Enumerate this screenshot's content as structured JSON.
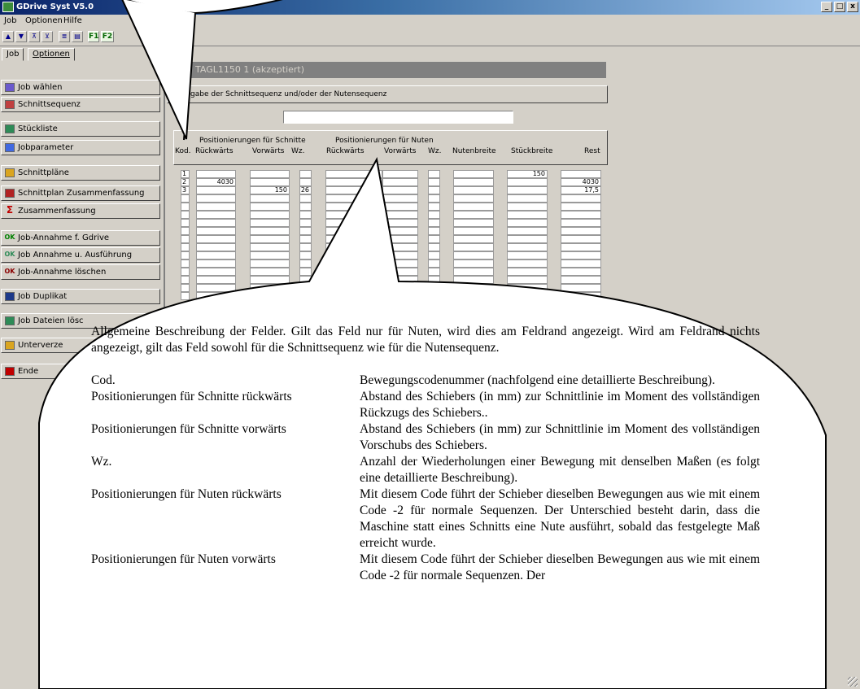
{
  "window": {
    "title": "GDrive Syst V5.0",
    "min": "_",
    "max": "□",
    "close": "x"
  },
  "menu": [
    "Job",
    "Optionen",
    "Hilfe"
  ],
  "toolbar": {
    "f1": "F1",
    "f2": "F2"
  },
  "tabs": [
    {
      "label": "Job"
    },
    {
      "label": "Optionen"
    }
  ],
  "sidebar": {
    "items": [
      {
        "label": "Job wählen",
        "icon": "folder-icon"
      },
      {
        "label": "Schnittsequenz",
        "icon": "sequence-icon"
      },
      {
        "label": "Stückliste",
        "icon": "list-icon"
      },
      {
        "label": "Jobparameter",
        "icon": "params-icon"
      },
      {
        "label": "Schnittpläne",
        "icon": "plan-icon"
      },
      {
        "label": "Schnittplan Zusammenfassung",
        "icon": "summary-plan-icon"
      },
      {
        "label": "Zusammenfassung",
        "icon": "sigma-icon",
        "glyph": "Σ"
      },
      {
        "label": "Job-Annahme f. Gdrive",
        "icon": "ok-icon",
        "glyph": "OK"
      },
      {
        "label": "Job Annahme u. Ausführung",
        "icon": "ok-run-icon",
        "glyph": "OK"
      },
      {
        "label": "Job-Annahme löschen",
        "icon": "ok-delete-icon",
        "glyph": "OK"
      },
      {
        "label": "Job Duplikat",
        "icon": "disk-icon"
      },
      {
        "label": "Job Dateien lösc",
        "icon": "delete-files-icon"
      },
      {
        "label": "Unterverze",
        "icon": "subfolder-icon"
      },
      {
        "label": "Ende",
        "icon": "exit-icon"
      }
    ]
  },
  "job_header": "TAGL1150  1 (akzeptiert)",
  "sequence_label": "gabe der Schnittsequenz und/oder der Nutensequenz",
  "sequence_input": "",
  "grid": {
    "group_cuts": "Positionierungen für Schnitte",
    "group_grooves": "Positionierungen für Nuten",
    "columns": [
      "Kod.",
      "Rückwärts",
      "Vorwärts",
      "Wz.",
      "Rückwärts",
      "Vorwärts",
      "Wz.",
      "Nutenbreite",
      "Stückbreite",
      "Rest"
    ],
    "rows": [
      {
        "kod": "1",
        "cut_back": "",
        "cut_fwd": "",
        "wz": "",
        "groove_back": "",
        "groove_fwd": "",
        "gwz": "",
        "groove_width": "",
        "piece_width": "150",
        "rest": ""
      },
      {
        "kod": "2",
        "cut_back": "4030",
        "cut_fwd": "",
        "wz": "",
        "groove_back": "",
        "groove_fwd": "",
        "gwz": "",
        "groove_width": "",
        "piece_width": "",
        "rest": "4030"
      },
      {
        "kod": "3",
        "cut_back": "",
        "cut_fwd": "150",
        "wz": "26",
        "groove_back": "",
        "groove_fwd": "",
        "gwz": "",
        "groove_width": "",
        "piece_width": "",
        "rest": "17,5"
      }
    ]
  },
  "description": {
    "intro": "Allgemeine Beschreibung der Felder. Gilt das Feld nur für Nuten, wird dies am Feldrand angezeigt. Wird am Feldrand nichts angezeigt, gilt das Feld sowohl für die Schnittsequenz wie für die Nutensequenz.",
    "fields": [
      {
        "term": "Cod.",
        "text": "Bewegungscodenummer (nachfolgend eine detaillierte Beschreibung)."
      },
      {
        "term": "Positionierungen für Schnitte rückwärts",
        "text": "Abstand des Schiebers (in mm) zur Schnittlinie im Moment des vollständigen Rückzugs des Schiebers.."
      },
      {
        "term": "Positionierungen für Schnitte vorwärts",
        "text": "Abstand des Schiebers (in mm) zur Schnittlinie im Moment des vollständigen Vorschubs des Schiebers."
      },
      {
        "term": "Wz.",
        "text": "Anzahl der Wiederholungen einer Bewegung mit denselben Maßen (es folgt eine detaillierte Beschreibung)."
      },
      {
        "term": "Positionierungen für Nuten rückwärts",
        "text": "Mit diesem Code führt der Schieber dieselben Bewegungen aus wie mit einem Code -2 für normale Sequenzen. Der Unterschied besteht darin, dass die Maschine statt eines Schnitts eine Nute ausführt, sobald das festgelegte Maß erreicht wurde."
      },
      {
        "term": "Positionierungen für Nuten vorwärts",
        "text": "Mit diesem Code führt der Schieber dieselben Bewegungen aus wie mit einem Code -2 für normale Sequenzen. Der"
      }
    ]
  }
}
